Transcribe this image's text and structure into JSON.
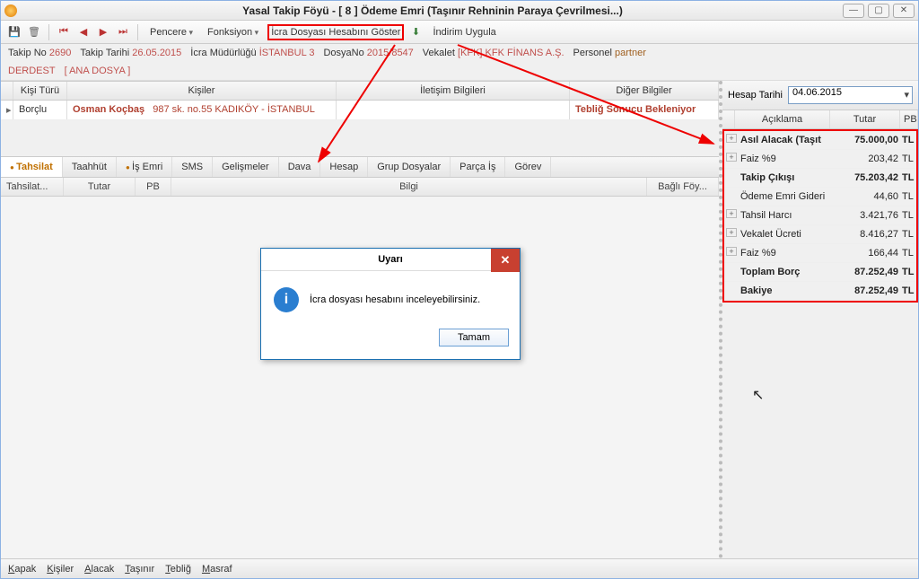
{
  "window": {
    "title": "Yasal Takip Föyü - [ 8 ] Ödeme Emri (Taşınır Rehninin Paraya Çevrilmesi...)"
  },
  "toolbar": {
    "pencere": "Pencere",
    "fonksiyon": "Fonksiyon",
    "icra_goster": "İcra Dosyası Hesabını Göster",
    "indirim": "İndirim Uygula"
  },
  "info": {
    "takip_no_k": "Takip No",
    "takip_no_v": "2690",
    "takip_tarihi_k": "Takip Tarihi",
    "takip_tarihi_v": "26.05.2015",
    "icra_mud_k": "İcra Müdürlüğü",
    "icra_mud_v": "İSTANBUL 3",
    "dosya_no_k": "DosyaNo",
    "dosya_no_v": "2015/8547",
    "vekalet_k": "Vekalet",
    "vekalet_v": "[KFK] KFK FİNANS A.Ş.",
    "personel_k": "Personel",
    "personel_v": "partner",
    "derdest": "DERDEST",
    "ana_dosya": "[ ANA DOSYA ]"
  },
  "kisiler": {
    "h_kisi_turu": "Kişi Türü",
    "h_kisiler": "Kişiler",
    "h_iletisim": "İletişim Bilgileri",
    "h_diger": "Diğer Bilgiler",
    "row_kisi_turu": "Borçlu",
    "row_ad": "Osman Koçbaş",
    "row_adres": "987 sk. no.55    KADIKÖY  -  İSTANBUL",
    "row_diger": "Tebliğ Sonucu Bekleniyor"
  },
  "tabs": [
    "Tahsilat",
    "Taahhüt",
    "İş Emri",
    "SMS",
    "Gelişmeler",
    "Dava",
    "Hesap",
    "Grup Dosyalar",
    "Parça İş",
    "Görev"
  ],
  "subhead": {
    "c1": "Tahsilat...",
    "c2": "Tutar",
    "c3": "PB",
    "c4": "Bilgi",
    "c5": "Bağlı Föy..."
  },
  "right": {
    "hesap_tarihi_k": "Hesap Tarihi",
    "hesap_tarihi_v": "04.06.2015",
    "h_aciklama": "Açıklama",
    "h_tutar": "Tutar",
    "h_pb": "PB",
    "rows": [
      {
        "exp": true,
        "bold": true,
        "lbl": "Asıl Alacak (Taşıt",
        "amt": "75.000,00",
        "cur": "TL"
      },
      {
        "exp": true,
        "bold": false,
        "lbl": "Faiz  %9",
        "amt": "203,42",
        "cur": "TL"
      },
      {
        "exp": false,
        "bold": true,
        "lbl": "Takip Çıkışı",
        "amt": "75.203,42",
        "cur": "TL"
      },
      {
        "exp": false,
        "bold": false,
        "lbl": "Ödeme Emri Gideri",
        "amt": "44,60",
        "cur": "TL"
      },
      {
        "exp": true,
        "bold": false,
        "lbl": "Tahsil Harcı",
        "amt": "3.421,76",
        "cur": "TL"
      },
      {
        "exp": true,
        "bold": false,
        "lbl": "Vekalet Ücreti",
        "amt": "8.416,27",
        "cur": "TL"
      },
      {
        "exp": true,
        "bold": false,
        "lbl": "Faiz  %9",
        "amt": "166,44",
        "cur": "TL"
      },
      {
        "exp": false,
        "bold": true,
        "lbl": "Toplam Borç",
        "amt": "87.252,49",
        "cur": "TL"
      },
      {
        "exp": false,
        "bold": true,
        "lbl": "Bakiye",
        "amt": "87.252,49",
        "cur": "TL"
      }
    ]
  },
  "dialog": {
    "title": "Uyarı",
    "msg": "İcra dosyası hesabını inceleyebilirsiniz.",
    "ok": "Tamam"
  },
  "status": [
    "Kapak",
    "Kişiler",
    "Alacak",
    "Taşınır",
    "Tebliğ",
    "Masraf"
  ]
}
